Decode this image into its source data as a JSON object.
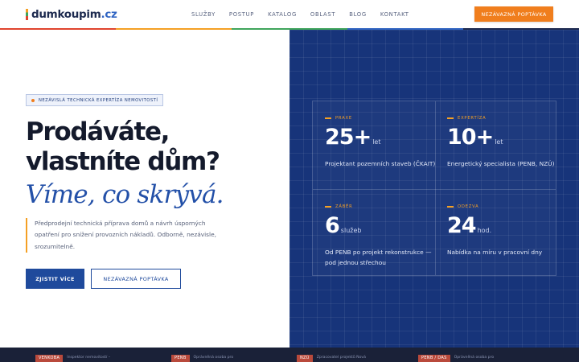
{
  "header": {
    "logo_main": "dumkoupim",
    "logo_tld": ".cz",
    "nav": [
      "SLUŽBY",
      "POSTUP",
      "KATALOG",
      "OBLAST",
      "BLOG",
      "KONTAKT"
    ],
    "cta": "NEZÁVAZNÁ POPTÁVKA"
  },
  "hero": {
    "badge": "NEZÁVISLÁ TECHNICKÁ EXPERTÍZA NEMOVITOSTÍ",
    "title_line1": "Prodáváte,",
    "title_line2": "vlastníte dům?",
    "title_italic": "Víme, co skrývá.",
    "lead": "Předprodejní technická příprava domů a návrh úsporných opatření pro snížení provozních nákladů. Odborně, nezávisle, srozumitelně.",
    "btn_primary": "ZJISTIT VÍCE",
    "btn_secondary": "NEZÁVAZNÁ POPTÁVKA"
  },
  "stats": [
    {
      "label": "PRAXE",
      "value": "25+",
      "unit": "let",
      "desc": "Projektant pozemních staveb (ČKAIT)"
    },
    {
      "label": "EXPERTÍZA",
      "value": "10+",
      "unit": "let",
      "desc": "Energetický specialista (PENB, NZÚ)"
    },
    {
      "label": "ZÁBĚR",
      "value": "6",
      "unit": "služeb",
      "desc": "Od PENB po projekt rekonstrukce — pod jednou střechou"
    },
    {
      "label": "ODEZVA",
      "value": "24",
      "unit": "hod.",
      "desc": "Nabídka na míru v pracovní dny"
    }
  ],
  "bottom": [
    {
      "tag": "VENKOBA",
      "text": "Inspektor nemovitostí –"
    },
    {
      "tag": "PENB",
      "text": "Oprávněná osoba pro"
    },
    {
      "tag": "NZÚ",
      "text": "Zpracovatel projektů Nová"
    },
    {
      "tag": "PENB / DAS",
      "text": "Oprávněná osoba pro"
    }
  ],
  "colors": {
    "accent": "#f07e1d",
    "brand": "#1f4a9c",
    "panel": "#17347a"
  }
}
